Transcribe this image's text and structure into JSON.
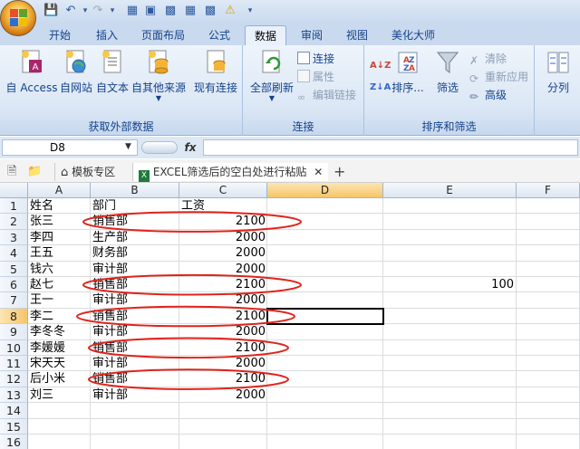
{
  "ribbon_tabs": [
    "开始",
    "插入",
    "页面布局",
    "公式",
    "数据",
    "审阅",
    "视图",
    "美化大师"
  ],
  "active_tab": "数据",
  "groups": {
    "external_label": "获取外部数据",
    "connections_label": "连接",
    "sort_label": "排序和筛选"
  },
  "buttons": {
    "from_access": "自 Access",
    "from_web": "自网站",
    "from_text": "自文本",
    "from_other": "自其他来源",
    "existing": "现有连接",
    "refresh_all": "全部刷新",
    "connections": "连接",
    "properties": "属性",
    "edit_links": "编辑链接",
    "sort_az": "A↓Z",
    "sort_za": "Z↓A",
    "sort": "排序...",
    "filter": "筛选",
    "clear": "清除",
    "reapply": "重新应用",
    "advanced": "高级",
    "split": "分列"
  },
  "name_box": "D8",
  "fx": "fx",
  "doc_tabs": {
    "template": "模板专区",
    "file": "EXCEL筛选后的空白处进行粘贴"
  },
  "columns": [
    "A",
    "B",
    "C",
    "D",
    "E",
    "F"
  ],
  "selected_column": "D",
  "selected_row": "8",
  "rows": [
    "1",
    "2",
    "3",
    "4",
    "5",
    "6",
    "7",
    "8",
    "9",
    "10",
    "11",
    "12",
    "13",
    "14",
    "15",
    "16"
  ],
  "table": [
    {
      "a": "姓名",
      "b": "部门",
      "c": "工资"
    },
    {
      "a": "张三",
      "b": "销售部",
      "c": "2100"
    },
    {
      "a": "李四",
      "b": "生产部",
      "c": "2000"
    },
    {
      "a": "王五",
      "b": "财务部",
      "c": "2000"
    },
    {
      "a": "钱六",
      "b": "审计部",
      "c": "2000"
    },
    {
      "a": "赵七",
      "b": "销售部",
      "c": "2100"
    },
    {
      "a": "王一",
      "b": "审计部",
      "c": "2000"
    },
    {
      "a": "李二",
      "b": "销售部",
      "c": "2100"
    },
    {
      "a": "李冬冬",
      "b": "审计部",
      "c": "2000"
    },
    {
      "a": "李媛媛",
      "b": "销售部",
      "c": "2100"
    },
    {
      "a": "宋天天",
      "b": "审计部",
      "c": "2000"
    },
    {
      "a": "后小米",
      "b": "销售部",
      "c": "2100"
    },
    {
      "a": "刘三",
      "b": "审计部",
      "c": "2000"
    }
  ],
  "e6_value": "100",
  "annotation_color": "#e0231b",
  "highlight_color": "#f6c46a"
}
